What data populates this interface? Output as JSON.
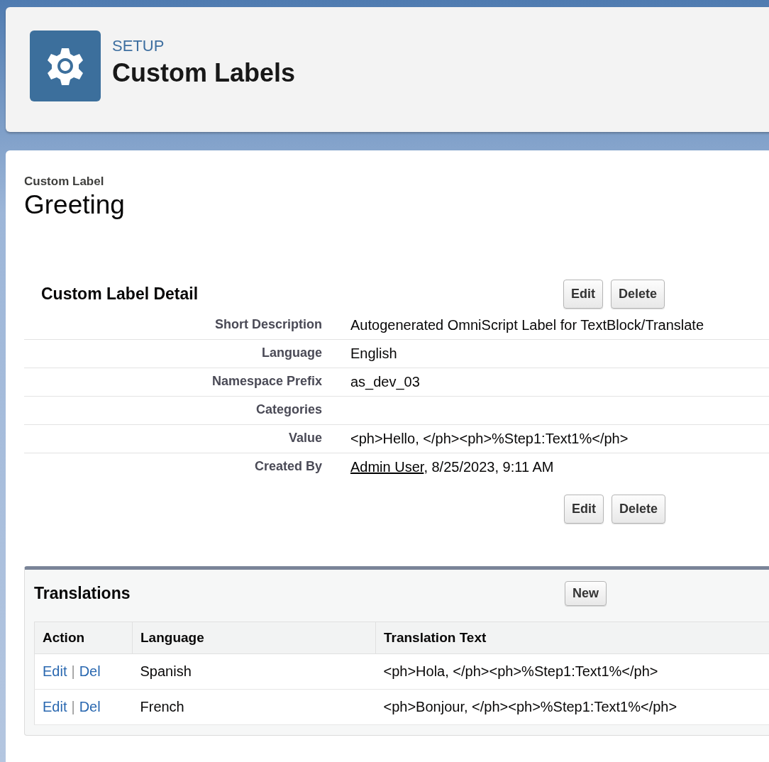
{
  "header": {
    "eyebrow": "SETUP",
    "title": "Custom Labels"
  },
  "record": {
    "type_label": "Custom Label",
    "name": "Greeting"
  },
  "detail": {
    "title": "Custom Label Detail",
    "top_buttons": [
      "Edit",
      "Delete"
    ],
    "bottom_buttons": [
      "Edit",
      "Delete"
    ],
    "fields": [
      {
        "label": "Short Description",
        "value": "Autogenerated OmniScript Label for TextBlock/Translate"
      },
      {
        "label": "Language",
        "value": "English"
      },
      {
        "label": "Namespace Prefix",
        "value": "as_dev_03"
      },
      {
        "label": "Categories"
      },
      {
        "label": "Value",
        "value": "<ph>Hello, </ph><ph>%Step1:Text1%</ph>"
      },
      {
        "label": "Created By",
        "link": "Admin User",
        "value": ", 8/25/2023, 9:11 AM"
      }
    ]
  },
  "translations": {
    "title": "Translations",
    "new_button": "New",
    "columns": [
      "Action",
      "Language",
      "Translation Text"
    ],
    "rows": [
      {
        "actions": [
          "Edit",
          "Del"
        ],
        "separator": "|",
        "language": "Spanish",
        "text": "<ph>Hola, </ph><ph>%Step1:Text1%</ph>"
      },
      {
        "actions": [
          "Edit",
          "Del"
        ],
        "separator": "|",
        "language": "French",
        "text": "<ph>Bonjour, </ph><ph>%Step1:Text1%</ph>"
      }
    ]
  }
}
